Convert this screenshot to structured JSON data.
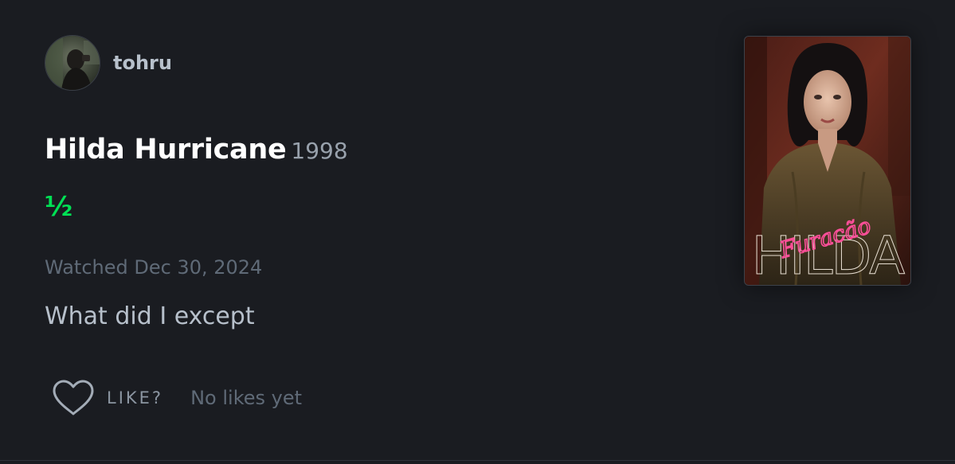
{
  "review": {
    "author": {
      "username": "tohru",
      "avatar_alt": "avatar"
    },
    "film": {
      "title": "Hilda Hurricane",
      "year": "1998"
    },
    "rating": "½",
    "watched": "Watched Dec 30, 2024",
    "text": "What did I except",
    "like": {
      "label": "LIKE?",
      "count_text": "No likes yet"
    },
    "poster": {
      "title_text": "HILDA",
      "script_text": "Furacão"
    }
  },
  "colors": {
    "background": "#1a1c21",
    "rating_green": "#00e054",
    "username": "#b7c0cb",
    "muted": "#5f6a77",
    "neon_pink": "#ff4f9a"
  },
  "icons": {
    "like": "heart-outline-icon"
  }
}
